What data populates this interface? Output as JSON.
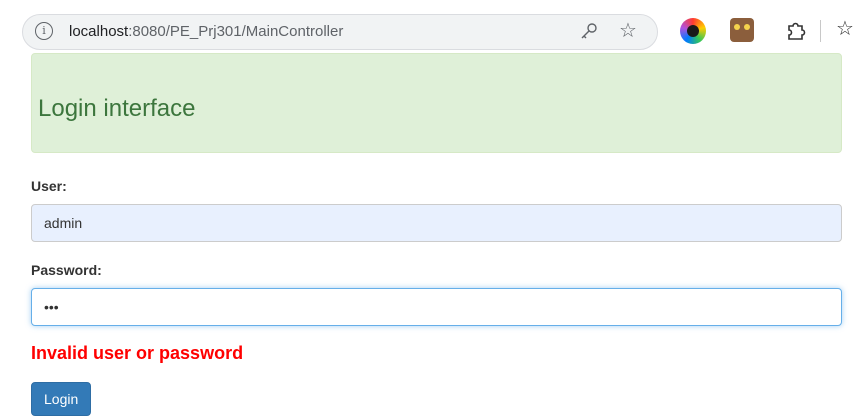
{
  "browser": {
    "url_host": "localhost",
    "url_rest": ":8080/PE_Prj301/MainController",
    "icons": [
      "info-icon",
      "key-icon",
      "star-icon",
      "extension-color-circle-icon",
      "extension-owl-icon",
      "puzzle-icon",
      "favorites-icon"
    ]
  },
  "header": {
    "title": "Login interface",
    "background_color": "#dff0d8",
    "text_color": "#3c763d"
  },
  "form": {
    "user_label": "User:",
    "user_value": "admin",
    "password_label": "Password:",
    "password_value": "123",
    "error_message": "Invalid user or password",
    "error_color": "#ff0000",
    "login_button_label": "Login",
    "button_color": "#337ab7"
  }
}
